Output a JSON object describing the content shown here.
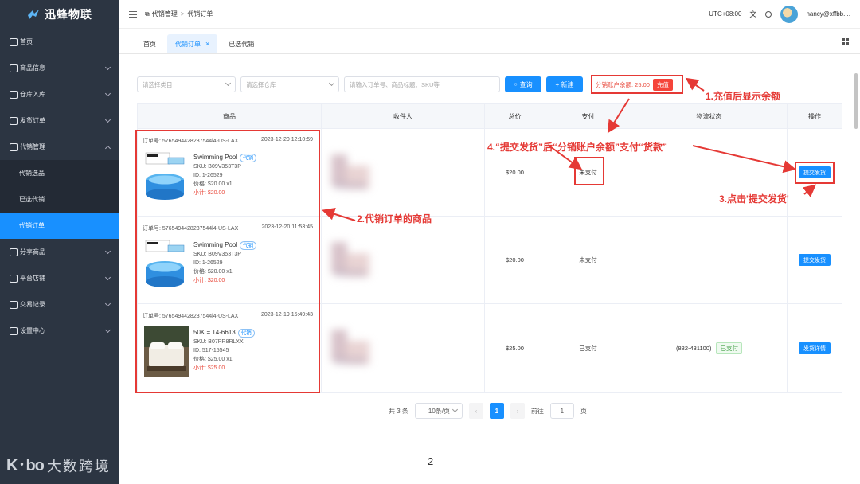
{
  "app": {
    "logo_text": "迅蜂物联"
  },
  "sidebar": {
    "items": [
      {
        "label": "首页",
        "icon": "home-icon"
      },
      {
        "label": "商品信息",
        "icon": "box-icon"
      },
      {
        "label": "仓库入库",
        "icon": "warehouse-icon"
      },
      {
        "label": "发货订单",
        "icon": "list-icon"
      },
      {
        "label": "代销管理",
        "icon": "external-icon"
      },
      {
        "label": "代销选品",
        "sub": true
      },
      {
        "label": "已选代销",
        "sub": true
      },
      {
        "label": "代销订单",
        "sub": true,
        "active": true
      },
      {
        "label": "分享商品",
        "icon": "share-icon"
      },
      {
        "label": "平台店铺",
        "icon": "store-icon"
      },
      {
        "label": "交易记录",
        "icon": "record-icon"
      },
      {
        "label": "设置中心",
        "icon": "gear-icon"
      }
    ]
  },
  "header": {
    "breadcrumb": [
      "代销管理",
      "代销订单"
    ],
    "timezone": "UTC+08:00",
    "user": "nancy@xffbb...."
  },
  "tabs": [
    {
      "label": "首页"
    },
    {
      "label": "代销订单",
      "active": true
    },
    {
      "label": "已选代销"
    }
  ],
  "filters": {
    "category_placeholder": "请选择类目",
    "warehouse_placeholder": "请选择仓库",
    "search_placeholder": "请输入订单号、商品标题、SKU等",
    "search_button": "查询",
    "new_button": "+ 新建",
    "balance_label": "分销账户余额: 25.00",
    "recharge_button": "充值"
  },
  "table": {
    "headers": [
      "商品",
      "收件人",
      "总价",
      "支付",
      "物流状态",
      "操作"
    ],
    "rows": [
      {
        "order_no": "订单号: 5765494428237544l4-US-LAX",
        "time": "2023-12-20 12:10:59",
        "product": "Swimming Pool",
        "tag": "代销",
        "sku": "SKU: B09V353T3P",
        "id": "ID: 1-26529",
        "price": "价格: $20.00 x1",
        "subtotal": "小计: $20.00",
        "total": "$20.00",
        "pay": "未支付",
        "logistics": "",
        "logistics_tag": "",
        "action": "提交发货",
        "img": "pool"
      },
      {
        "order_no": "订单号: 5765494428237544l4-US-LAX",
        "time": "2023-12-20 11:53:45",
        "product": "Swimming Pool",
        "tag": "代销",
        "sku": "SKU: B09V353T3P",
        "id": "ID: 1-26529",
        "price": "价格: $20.00 x1",
        "subtotal": "小计: $20.00",
        "total": "$20.00",
        "pay": "未支付",
        "logistics": "",
        "logistics_tag": "",
        "action": "提交发货",
        "img": "pool"
      },
      {
        "order_no": "订单号: 5765494428237544l4-US-LAX",
        "time": "2023-12-19 15:49:43",
        "product": "50K = 14-6613",
        "tag": "代销",
        "sku": "SKU: B07PR8RLXX",
        "id": "ID: 517-15545",
        "price": "价格: $25.00 x1",
        "subtotal": "小计: $25.00",
        "total": "$25.00",
        "pay": "已支付",
        "logistics": "(882-431100)",
        "logistics_tag": "已支付",
        "action": "发货详情",
        "img": "bed"
      }
    ]
  },
  "pagination": {
    "total": "共 3 条",
    "page_size": "10条/页",
    "current": "1",
    "goto_label": "前往",
    "goto_value": "1",
    "page_suffix": "页"
  },
  "annotations": {
    "a1": "1.充值后显示余额",
    "a2": "2.代销订单的商品",
    "a3": "3.点击'提交发货'",
    "a4": "4.“提交发货”后“分销账户余额”支付“货款”"
  },
  "footer": {
    "page_number": "2",
    "watermark_logo": "K᛫bo",
    "watermark_text": "大数跨境"
  },
  "colors": {
    "sidebar": "#2c3542",
    "accent": "#1890ff",
    "annotation": "#e53935"
  }
}
